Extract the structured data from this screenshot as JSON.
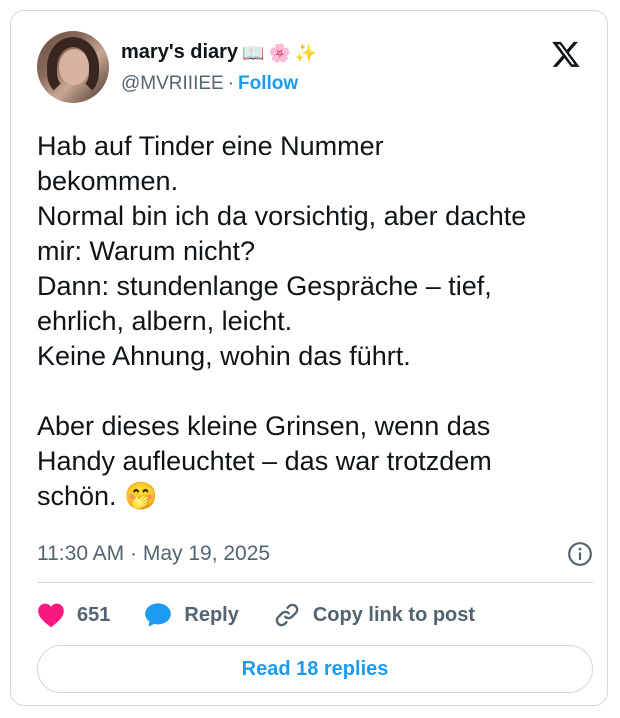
{
  "user": {
    "name": "mary's diary",
    "name_emojis": [
      "📖",
      "🌸",
      "✨"
    ],
    "handle": "@MVRIIIEE",
    "separator": "·",
    "follow_label": "Follow"
  },
  "tweet": {
    "text": "Hab auf Tinder eine Nummer\nbekommen.\nNormal bin ich da vorsichtig, aber dachte\nmir: Warum nicht?\nDann: stundenlange Gespräche – tief,\nehrlich, albern, leicht.\nKeine Ahnung, wohin das führt.\n\nAber dieses kleine Grinsen, wenn das\nHandy aufleuchtet – das war trotzdem\nschön. 🤭",
    "timestamp": "11:30 AM · May 19, 2025"
  },
  "actions": {
    "like_count": "651",
    "reply_label": "Reply",
    "copy_label": "Copy link to post"
  },
  "footer": {
    "read_replies_label": "Read 18 replies"
  },
  "icons": {
    "logo": "x-logo-icon",
    "info": "info-icon",
    "like": "heart-icon",
    "reply": "speech-bubble-icon",
    "copy": "link-icon"
  },
  "colors": {
    "accent": "#1d9bf0",
    "like": "#f91880",
    "muted": "#536471",
    "border": "#cfd9de"
  }
}
